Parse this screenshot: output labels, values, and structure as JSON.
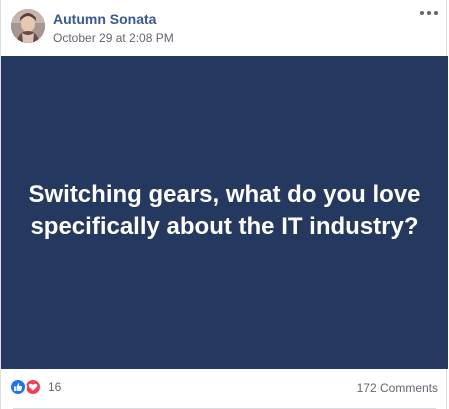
{
  "post": {
    "author": "Autumn Sonata",
    "timestamp": "October 29 at 2:08 PM",
    "text": "Switching gears, what do you love specifically about the IT industry?",
    "background_color": "#243860"
  },
  "footer": {
    "reaction_count": "16",
    "comments_label": "172 Comments",
    "reaction_icons": [
      "like-icon",
      "love-icon"
    ]
  },
  "colors": {
    "author_link": "#385898",
    "like_blue": "#1877f2",
    "love_red": "#f33e58"
  }
}
